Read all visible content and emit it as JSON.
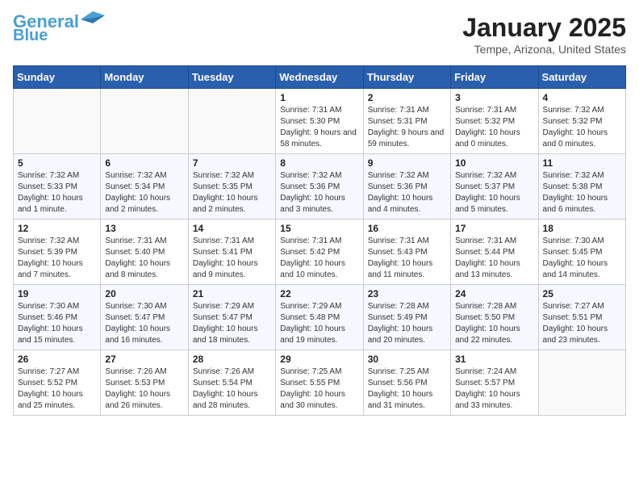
{
  "header": {
    "logo_line1": "General",
    "logo_line2": "Blue",
    "title": "January 2025",
    "subtitle": "Tempe, Arizona, United States"
  },
  "weekdays": [
    "Sunday",
    "Monday",
    "Tuesday",
    "Wednesday",
    "Thursday",
    "Friday",
    "Saturday"
  ],
  "weeks": [
    [
      {
        "day": "",
        "info": ""
      },
      {
        "day": "",
        "info": ""
      },
      {
        "day": "",
        "info": ""
      },
      {
        "day": "1",
        "info": "Sunrise: 7:31 AM\nSunset: 5:30 PM\nDaylight: 9 hours and 58 minutes."
      },
      {
        "day": "2",
        "info": "Sunrise: 7:31 AM\nSunset: 5:31 PM\nDaylight: 9 hours and 59 minutes."
      },
      {
        "day": "3",
        "info": "Sunrise: 7:31 AM\nSunset: 5:32 PM\nDaylight: 10 hours and 0 minutes."
      },
      {
        "day": "4",
        "info": "Sunrise: 7:32 AM\nSunset: 5:32 PM\nDaylight: 10 hours and 0 minutes."
      }
    ],
    [
      {
        "day": "5",
        "info": "Sunrise: 7:32 AM\nSunset: 5:33 PM\nDaylight: 10 hours and 1 minute."
      },
      {
        "day": "6",
        "info": "Sunrise: 7:32 AM\nSunset: 5:34 PM\nDaylight: 10 hours and 2 minutes."
      },
      {
        "day": "7",
        "info": "Sunrise: 7:32 AM\nSunset: 5:35 PM\nDaylight: 10 hours and 2 minutes."
      },
      {
        "day": "8",
        "info": "Sunrise: 7:32 AM\nSunset: 5:36 PM\nDaylight: 10 hours and 3 minutes."
      },
      {
        "day": "9",
        "info": "Sunrise: 7:32 AM\nSunset: 5:36 PM\nDaylight: 10 hours and 4 minutes."
      },
      {
        "day": "10",
        "info": "Sunrise: 7:32 AM\nSunset: 5:37 PM\nDaylight: 10 hours and 5 minutes."
      },
      {
        "day": "11",
        "info": "Sunrise: 7:32 AM\nSunset: 5:38 PM\nDaylight: 10 hours and 6 minutes."
      }
    ],
    [
      {
        "day": "12",
        "info": "Sunrise: 7:32 AM\nSunset: 5:39 PM\nDaylight: 10 hours and 7 minutes."
      },
      {
        "day": "13",
        "info": "Sunrise: 7:31 AM\nSunset: 5:40 PM\nDaylight: 10 hours and 8 minutes."
      },
      {
        "day": "14",
        "info": "Sunrise: 7:31 AM\nSunset: 5:41 PM\nDaylight: 10 hours and 9 minutes."
      },
      {
        "day": "15",
        "info": "Sunrise: 7:31 AM\nSunset: 5:42 PM\nDaylight: 10 hours and 10 minutes."
      },
      {
        "day": "16",
        "info": "Sunrise: 7:31 AM\nSunset: 5:43 PM\nDaylight: 10 hours and 11 minutes."
      },
      {
        "day": "17",
        "info": "Sunrise: 7:31 AM\nSunset: 5:44 PM\nDaylight: 10 hours and 13 minutes."
      },
      {
        "day": "18",
        "info": "Sunrise: 7:30 AM\nSunset: 5:45 PM\nDaylight: 10 hours and 14 minutes."
      }
    ],
    [
      {
        "day": "19",
        "info": "Sunrise: 7:30 AM\nSunset: 5:46 PM\nDaylight: 10 hours and 15 minutes."
      },
      {
        "day": "20",
        "info": "Sunrise: 7:30 AM\nSunset: 5:47 PM\nDaylight: 10 hours and 16 minutes."
      },
      {
        "day": "21",
        "info": "Sunrise: 7:29 AM\nSunset: 5:47 PM\nDaylight: 10 hours and 18 minutes."
      },
      {
        "day": "22",
        "info": "Sunrise: 7:29 AM\nSunset: 5:48 PM\nDaylight: 10 hours and 19 minutes."
      },
      {
        "day": "23",
        "info": "Sunrise: 7:28 AM\nSunset: 5:49 PM\nDaylight: 10 hours and 20 minutes."
      },
      {
        "day": "24",
        "info": "Sunrise: 7:28 AM\nSunset: 5:50 PM\nDaylight: 10 hours and 22 minutes."
      },
      {
        "day": "25",
        "info": "Sunrise: 7:27 AM\nSunset: 5:51 PM\nDaylight: 10 hours and 23 minutes."
      }
    ],
    [
      {
        "day": "26",
        "info": "Sunrise: 7:27 AM\nSunset: 5:52 PM\nDaylight: 10 hours and 25 minutes."
      },
      {
        "day": "27",
        "info": "Sunrise: 7:26 AM\nSunset: 5:53 PM\nDaylight: 10 hours and 26 minutes."
      },
      {
        "day": "28",
        "info": "Sunrise: 7:26 AM\nSunset: 5:54 PM\nDaylight: 10 hours and 28 minutes."
      },
      {
        "day": "29",
        "info": "Sunrise: 7:25 AM\nSunset: 5:55 PM\nDaylight: 10 hours and 30 minutes."
      },
      {
        "day": "30",
        "info": "Sunrise: 7:25 AM\nSunset: 5:56 PM\nDaylight: 10 hours and 31 minutes."
      },
      {
        "day": "31",
        "info": "Sunrise: 7:24 AM\nSunset: 5:57 PM\nDaylight: 10 hours and 33 minutes."
      },
      {
        "day": "",
        "info": ""
      }
    ]
  ]
}
